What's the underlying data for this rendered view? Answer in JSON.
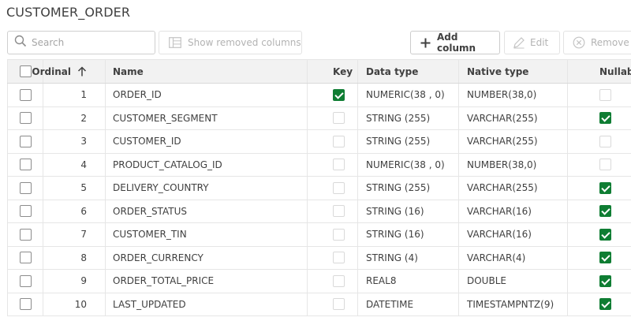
{
  "page": {
    "title": "CUSTOMER_ORDER"
  },
  "toolbar": {
    "search_placeholder": "Search",
    "show_removed_label": "Show removed columns",
    "add_column_label": "Add column",
    "edit_label": "Edit",
    "remove_label": "Remove"
  },
  "table": {
    "headers": {
      "ordinal": "Ordinal",
      "name": "Name",
      "key": "Key",
      "data_type": "Data type",
      "native_type": "Native type",
      "nullable": "Nullable"
    },
    "sort": {
      "column": "ordinal",
      "direction": "ascending"
    },
    "rows": [
      {
        "ordinal": "1",
        "name": "ORDER_ID",
        "key": true,
        "data_type": "NUMERIC(38 , 0)",
        "native_type": "NUMBER(38,0)",
        "nullable": false
      },
      {
        "ordinal": "2",
        "name": "CUSTOMER_SEGMENT",
        "key": false,
        "data_type": "STRING (255)",
        "native_type": "VARCHAR(255)",
        "nullable": true
      },
      {
        "ordinal": "3",
        "name": "CUSTOMER_ID",
        "key": false,
        "data_type": "STRING (255)",
        "native_type": "VARCHAR(255)",
        "nullable": false
      },
      {
        "ordinal": "4",
        "name": "PRODUCT_CATALOG_ID",
        "key": false,
        "data_type": "NUMERIC(38 , 0)",
        "native_type": "NUMBER(38,0)",
        "nullable": false
      },
      {
        "ordinal": "5",
        "name": "DELIVERY_COUNTRY",
        "key": false,
        "data_type": "STRING (255)",
        "native_type": "VARCHAR(255)",
        "nullable": true
      },
      {
        "ordinal": "6",
        "name": "ORDER_STATUS",
        "key": false,
        "data_type": "STRING (16)",
        "native_type": "VARCHAR(16)",
        "nullable": true
      },
      {
        "ordinal": "7",
        "name": "CUSTOMER_TIN",
        "key": false,
        "data_type": "STRING (16)",
        "native_type": "VARCHAR(16)",
        "nullable": true
      },
      {
        "ordinal": "8",
        "name": "ORDER_CURRENCY",
        "key": false,
        "data_type": "STRING (4)",
        "native_type": "VARCHAR(4)",
        "nullable": true
      },
      {
        "ordinal": "9",
        "name": "ORDER_TOTAL_PRICE",
        "key": false,
        "data_type": "REAL8",
        "native_type": "DOUBLE",
        "nullable": true
      },
      {
        "ordinal": "10",
        "name": "LAST_UPDATED",
        "key": false,
        "data_type": "DATETIME",
        "native_type": "TIMESTAMPNTZ(9)",
        "nullable": true
      }
    ]
  },
  "colors": {
    "check_green": "#0f7d33",
    "header_bg": "#f2f2f2",
    "border": "#e6e6e6"
  },
  "icons": {
    "search": "search-icon",
    "show_removed": "table-columns-icon",
    "add": "plus-icon",
    "edit": "pencil-icon",
    "remove": "remove-circle-icon",
    "sort": "arrow-up-icon"
  }
}
